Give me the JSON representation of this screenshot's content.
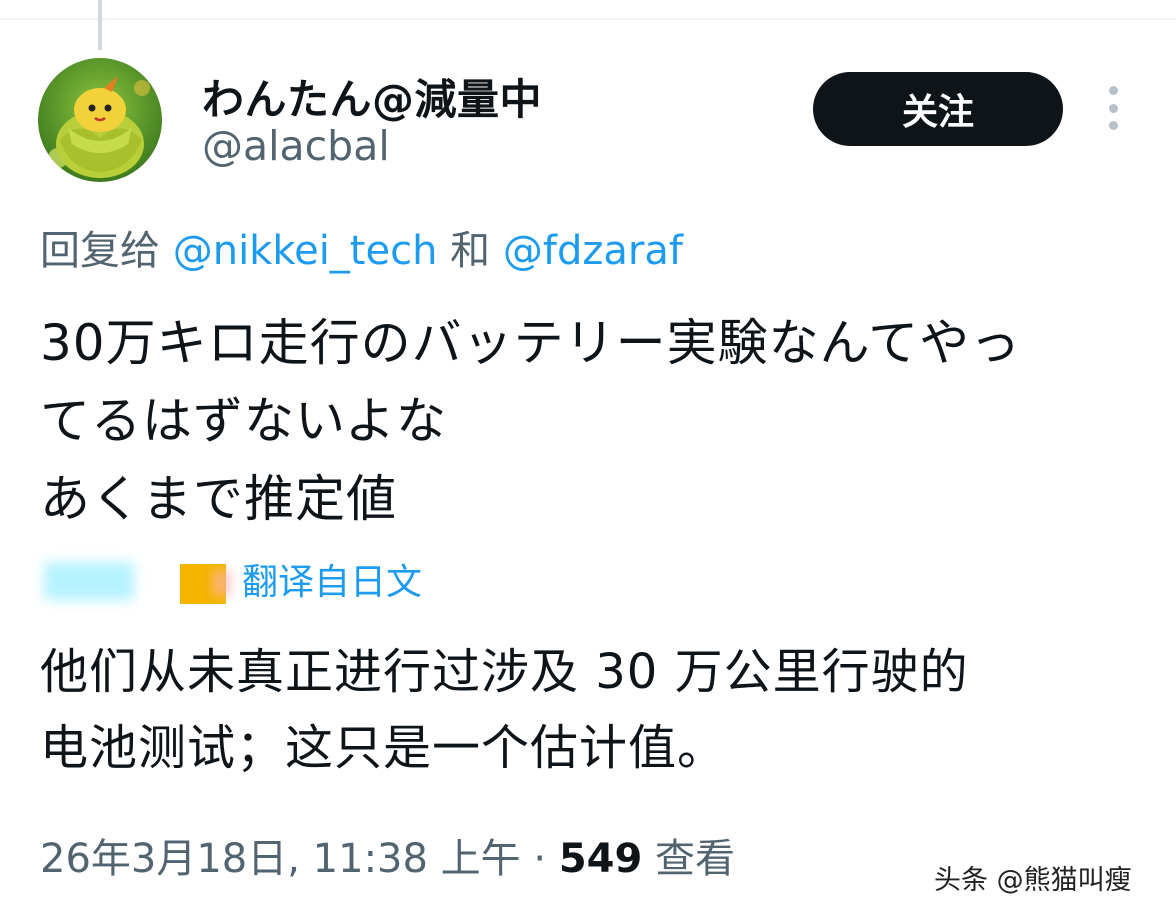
{
  "tweet": {
    "display_name": "わんたん@減量中",
    "handle": "@alacbal",
    "follow_label": "关注",
    "reply_prefix": "回复给",
    "reply_mention_1": "@nikkei_tech",
    "reply_conjunction": "和",
    "reply_mention_2": "@fdzaraf",
    "text_lines": [
      "30万キロ走行のバッテリー実験なんてやっ",
      "てるはずないよな",
      "あくまで推定値"
    ],
    "translation_label": "翻译自日文",
    "translated_lines": [
      "他们从未真正进行过涉及 30 万公里行驶的",
      "电池测试；这只是一个估计值。"
    ],
    "timestamp": "26年3月18日, 11:38 上午",
    "separator": "·",
    "view_count": "549",
    "view_label": "查看"
  },
  "watermark": "头条 @熊猫叫瘦",
  "colors": {
    "text_primary": "#0f1419",
    "text_secondary": "#536471",
    "link": "#1d9bf0",
    "button_bg": "#0f1419",
    "button_text": "#ffffff"
  },
  "icons": {
    "more": "more-vertical-icon"
  }
}
